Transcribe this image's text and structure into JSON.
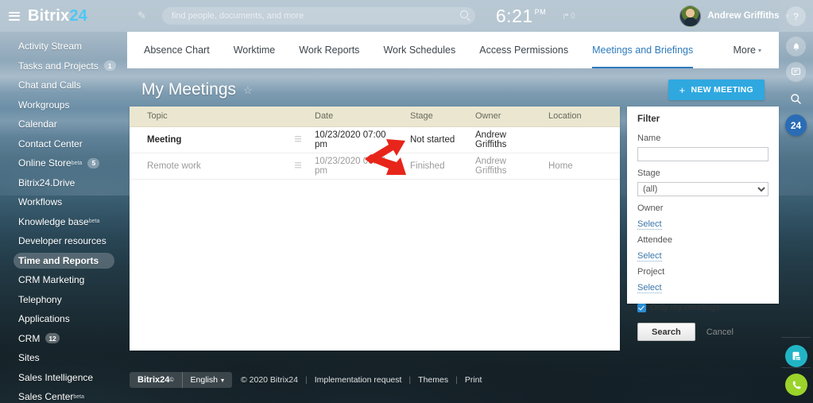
{
  "header": {
    "brand_text": "Bitrix",
    "brand_number": "24",
    "menu_icon": "hamburger-icon",
    "pencil_icon": "pencil-icon",
    "search_placeholder": "find people, documents, and more",
    "search_value": "",
    "search_icon": "search-icon",
    "clock_time": "6:21",
    "clock_ampm": "PM",
    "counter_value": "0",
    "user_name": "Andrew Griffiths",
    "user_caret": "▾"
  },
  "sidebar": {
    "items": [
      {
        "label": "Activity Stream",
        "badge": "",
        "beta": false,
        "active": false
      },
      {
        "label": "Tasks and Projects",
        "badge": "1",
        "beta": false,
        "active": false
      },
      {
        "label": "Chat and Calls",
        "badge": "",
        "beta": false,
        "active": false
      },
      {
        "label": "Workgroups",
        "badge": "",
        "beta": false,
        "active": false
      },
      {
        "label": "Calendar",
        "badge": "",
        "beta": false,
        "active": false
      },
      {
        "label": "Contact Center",
        "badge": "",
        "beta": false,
        "active": false
      },
      {
        "label": "Online Store",
        "badge": "5",
        "beta": true,
        "active": false
      },
      {
        "label": "Bitrix24.Drive",
        "badge": "",
        "beta": false,
        "active": false
      },
      {
        "label": "Workflows",
        "badge": "",
        "beta": false,
        "active": false
      },
      {
        "label": "Knowledge base",
        "badge": "",
        "beta": true,
        "active": false
      },
      {
        "label": "Developer resources",
        "badge": "",
        "beta": false,
        "active": false
      },
      {
        "label": "Time and Reports",
        "badge": "",
        "beta": false,
        "active": true
      },
      {
        "label": "CRM Marketing",
        "badge": "",
        "beta": false,
        "active": false
      },
      {
        "label": "Telephony",
        "badge": "",
        "beta": false,
        "active": false
      },
      {
        "label": "Applications",
        "badge": "",
        "beta": false,
        "active": false
      },
      {
        "label": "CRM",
        "badge": "12",
        "beta": false,
        "active": false
      },
      {
        "label": "Sites",
        "badge": "",
        "beta": false,
        "active": false
      },
      {
        "label": "Sales Intelligence",
        "badge": "",
        "beta": false,
        "active": false
      },
      {
        "label": "Sales Center",
        "badge": "",
        "beta": true,
        "active": false
      }
    ],
    "beta_suffix": "beta"
  },
  "tabs": {
    "items": [
      {
        "label": "Absence Chart",
        "selected": false
      },
      {
        "label": "Worktime",
        "selected": false
      },
      {
        "label": "Work Reports",
        "selected": false
      },
      {
        "label": "Work Schedules",
        "selected": false
      },
      {
        "label": "Access Permissions",
        "selected": false
      },
      {
        "label": "Meetings and Briefings",
        "selected": true
      }
    ],
    "more_label": "More",
    "more_caret": "▾"
  },
  "page": {
    "title": "My Meetings",
    "star_icon": "☆",
    "new_meeting_label": "NEW MEETING",
    "new_meeting_plus": "+",
    "accent_color": "#2fa8e0"
  },
  "table": {
    "columns": [
      "Topic",
      "",
      "Date",
      "Stage",
      "Owner",
      "Location"
    ],
    "rows": [
      {
        "topic": "Meeting",
        "grip": "grip-icon",
        "date": "10/23/2020 07:00 pm",
        "stage": "Not started",
        "owner": "Andrew Griffiths",
        "location": ""
      },
      {
        "topic": "Remote work",
        "grip": "grip-icon",
        "date": "10/23/2020 06:46 pm",
        "stage": "Finished",
        "owner": "Andrew Griffiths",
        "location": "Home"
      }
    ]
  },
  "filter": {
    "title": "Filter",
    "name_label": "Name",
    "name_value": "",
    "stage_label": "Stage",
    "stage_selected": "(all)",
    "stage_options": [
      "(all)"
    ],
    "owner_label": "Owner",
    "owner_link": "Select",
    "attendee_label": "Attendee",
    "attendee_link": "Select",
    "project_label": "Project",
    "project_link": "Select",
    "only_my_label": "Only my meetings",
    "only_my_checked": true,
    "search_label": "Search",
    "cancel_label": "Cancel",
    "check_color": "#2a8ed6"
  },
  "footer": {
    "brand": "Bitrix24",
    "brand_sup": "©",
    "language": "English",
    "language_caret": "▾",
    "copyright": "© 2020 Bitrix24",
    "links": [
      "Implementation request",
      "Themes",
      "Print"
    ],
    "separator": "|"
  },
  "rail": {
    "help_icon": "question-mark-icon",
    "help_glyph": "?",
    "notifications_icon": "bell-icon",
    "notifications_glyph": "🔔",
    "chat_icon": "chat-bubble-icon",
    "search_icon": "search-icon",
    "badge_24": "24",
    "doc_icon": "document-scan-icon",
    "call_icon": "phone-icon"
  },
  "annotations": {
    "arrow_color": "#e8251a",
    "arrow_up_target": "Not started",
    "arrow_down_target": "Finished"
  }
}
